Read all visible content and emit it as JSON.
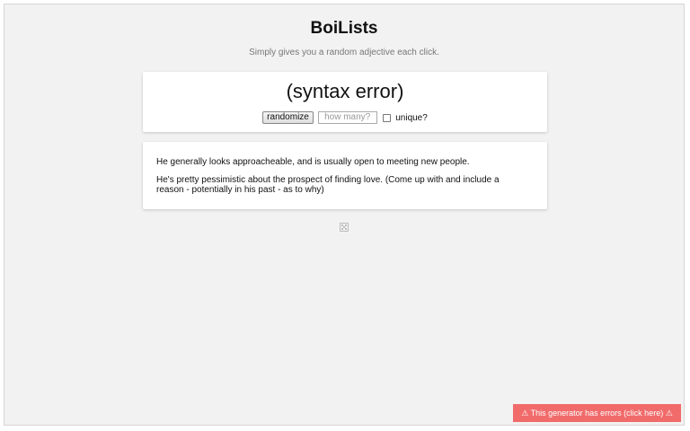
{
  "header": {
    "title": "BoiLists",
    "subtitle": "Simply gives you a random adjective each click."
  },
  "generator": {
    "output": "(syntax error)",
    "randomize_label": "randomize",
    "count_placeholder": "how many?",
    "unique_label": "unique?",
    "unique_checked": false
  },
  "notes": [
    "He generally looks approacheable, and is usually open to meeting new people.",
    "He's pretty pessimistic about the prospect of finding love. (Come up with and include a reason - potentially in his past - as to why)"
  ],
  "footer": {
    "dice_icon": "dice-icon",
    "error_notice": "⚠ This generator has errors (click here) ⚠",
    "error_color": "#f16b6b"
  }
}
